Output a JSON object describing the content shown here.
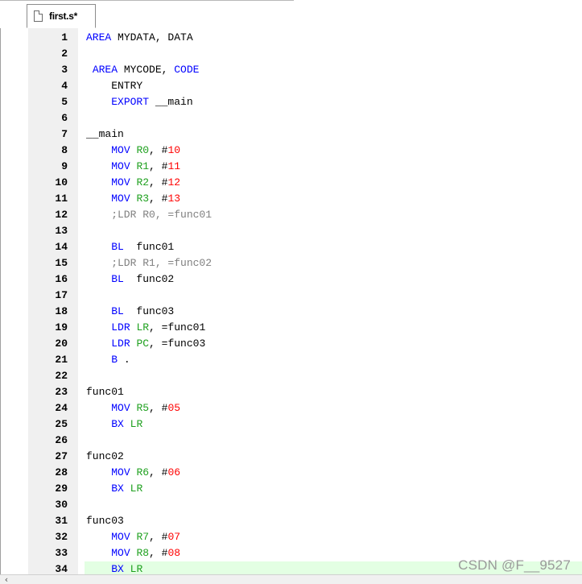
{
  "tab": {
    "label": "first.s*",
    "icon": "file-icon"
  },
  "editor": {
    "current_line": 34,
    "lines": [
      {
        "n": "1",
        "tokens": [
          {
            "t": "AREA",
            "c": "kw"
          },
          {
            "t": " MYDATA, DATA",
            "c": "plain"
          }
        ]
      },
      {
        "n": "2",
        "tokens": []
      },
      {
        "n": "3",
        "tokens": [
          {
            "t": " ",
            "c": "plain"
          },
          {
            "t": "AREA",
            "c": "kw"
          },
          {
            "t": " MYCODE, ",
            "c": "plain"
          },
          {
            "t": "CODE",
            "c": "kw"
          }
        ]
      },
      {
        "n": "4",
        "tokens": [
          {
            "t": "    ENTRY",
            "c": "plain"
          }
        ]
      },
      {
        "n": "5",
        "tokens": [
          {
            "t": "    ",
            "c": "plain"
          },
          {
            "t": "EXPORT",
            "c": "kw"
          },
          {
            "t": " __main",
            "c": "plain"
          }
        ]
      },
      {
        "n": "6",
        "tokens": []
      },
      {
        "n": "7",
        "tokens": [
          {
            "t": "__main",
            "c": "plain"
          }
        ]
      },
      {
        "n": "8",
        "tokens": [
          {
            "t": "    ",
            "c": "plain"
          },
          {
            "t": "MOV",
            "c": "kw"
          },
          {
            "t": " ",
            "c": "plain"
          },
          {
            "t": "R0",
            "c": "reg"
          },
          {
            "t": ", #",
            "c": "plain"
          },
          {
            "t": "10",
            "c": "num"
          }
        ]
      },
      {
        "n": "9",
        "tokens": [
          {
            "t": "    ",
            "c": "plain"
          },
          {
            "t": "MOV",
            "c": "kw"
          },
          {
            "t": " ",
            "c": "plain"
          },
          {
            "t": "R1",
            "c": "reg"
          },
          {
            "t": ", #",
            "c": "plain"
          },
          {
            "t": "11",
            "c": "num"
          }
        ]
      },
      {
        "n": "10",
        "tokens": [
          {
            "t": "    ",
            "c": "plain"
          },
          {
            "t": "MOV",
            "c": "kw"
          },
          {
            "t": " ",
            "c": "plain"
          },
          {
            "t": "R2",
            "c": "reg"
          },
          {
            "t": ", #",
            "c": "plain"
          },
          {
            "t": "12",
            "c": "num"
          }
        ]
      },
      {
        "n": "11",
        "tokens": [
          {
            "t": "    ",
            "c": "plain"
          },
          {
            "t": "MOV",
            "c": "kw"
          },
          {
            "t": " ",
            "c": "plain"
          },
          {
            "t": "R3",
            "c": "reg"
          },
          {
            "t": ", #",
            "c": "plain"
          },
          {
            "t": "13",
            "c": "num"
          }
        ]
      },
      {
        "n": "12",
        "tokens": [
          {
            "t": "    ;LDR R0, =func01",
            "c": "cmt"
          }
        ]
      },
      {
        "n": "13",
        "tokens": []
      },
      {
        "n": "14",
        "tokens": [
          {
            "t": "    ",
            "c": "plain"
          },
          {
            "t": "BL",
            "c": "kw"
          },
          {
            "t": "  func01",
            "c": "plain"
          }
        ]
      },
      {
        "n": "15",
        "tokens": [
          {
            "t": "    ;LDR R1, =func02",
            "c": "cmt"
          }
        ]
      },
      {
        "n": "16",
        "tokens": [
          {
            "t": "    ",
            "c": "plain"
          },
          {
            "t": "BL",
            "c": "kw"
          },
          {
            "t": "  func02",
            "c": "plain"
          }
        ]
      },
      {
        "n": "17",
        "tokens": []
      },
      {
        "n": "18",
        "tokens": [
          {
            "t": "    ",
            "c": "plain"
          },
          {
            "t": "BL",
            "c": "kw"
          },
          {
            "t": "  func03",
            "c": "plain"
          }
        ]
      },
      {
        "n": "19",
        "tokens": [
          {
            "t": "    ",
            "c": "plain"
          },
          {
            "t": "LDR",
            "c": "kw"
          },
          {
            "t": " ",
            "c": "plain"
          },
          {
            "t": "LR",
            "c": "reg"
          },
          {
            "t": ", =func01",
            "c": "plain"
          }
        ]
      },
      {
        "n": "20",
        "tokens": [
          {
            "t": "    ",
            "c": "plain"
          },
          {
            "t": "LDR",
            "c": "kw"
          },
          {
            "t": " ",
            "c": "plain"
          },
          {
            "t": "PC",
            "c": "reg"
          },
          {
            "t": ", =func03",
            "c": "plain"
          }
        ]
      },
      {
        "n": "21",
        "tokens": [
          {
            "t": "    ",
            "c": "plain"
          },
          {
            "t": "B",
            "c": "kw"
          },
          {
            "t": " .",
            "c": "plain"
          }
        ]
      },
      {
        "n": "22",
        "tokens": []
      },
      {
        "n": "23",
        "tokens": [
          {
            "t": "func01",
            "c": "plain"
          }
        ]
      },
      {
        "n": "24",
        "tokens": [
          {
            "t": "    ",
            "c": "plain"
          },
          {
            "t": "MOV",
            "c": "kw"
          },
          {
            "t": " ",
            "c": "plain"
          },
          {
            "t": "R5",
            "c": "reg"
          },
          {
            "t": ", #",
            "c": "plain"
          },
          {
            "t": "05",
            "c": "num"
          }
        ]
      },
      {
        "n": "25",
        "tokens": [
          {
            "t": "    ",
            "c": "plain"
          },
          {
            "t": "BX",
            "c": "kw"
          },
          {
            "t": " ",
            "c": "plain"
          },
          {
            "t": "LR",
            "c": "reg"
          }
        ]
      },
      {
        "n": "26",
        "tokens": []
      },
      {
        "n": "27",
        "tokens": [
          {
            "t": "func02",
            "c": "plain"
          }
        ]
      },
      {
        "n": "28",
        "tokens": [
          {
            "t": "    ",
            "c": "plain"
          },
          {
            "t": "MOV",
            "c": "kw"
          },
          {
            "t": " ",
            "c": "plain"
          },
          {
            "t": "R6",
            "c": "reg"
          },
          {
            "t": ", #",
            "c": "plain"
          },
          {
            "t": "06",
            "c": "num"
          }
        ]
      },
      {
        "n": "29",
        "tokens": [
          {
            "t": "    ",
            "c": "plain"
          },
          {
            "t": "BX",
            "c": "kw"
          },
          {
            "t": " ",
            "c": "plain"
          },
          {
            "t": "LR",
            "c": "reg"
          }
        ]
      },
      {
        "n": "30",
        "tokens": []
      },
      {
        "n": "31",
        "tokens": [
          {
            "t": "func03",
            "c": "plain"
          }
        ]
      },
      {
        "n": "32",
        "tokens": [
          {
            "t": "    ",
            "c": "plain"
          },
          {
            "t": "MOV",
            "c": "kw"
          },
          {
            "t": " ",
            "c": "plain"
          },
          {
            "t": "R7",
            "c": "reg"
          },
          {
            "t": ", #",
            "c": "plain"
          },
          {
            "t": "07",
            "c": "num"
          }
        ]
      },
      {
        "n": "33",
        "tokens": [
          {
            "t": "    ",
            "c": "plain"
          },
          {
            "t": "MOV",
            "c": "kw"
          },
          {
            "t": " ",
            "c": "plain"
          },
          {
            "t": "R8",
            "c": "reg"
          },
          {
            "t": ", #",
            "c": "plain"
          },
          {
            "t": "08",
            "c": "num"
          }
        ]
      },
      {
        "n": "34",
        "tokens": [
          {
            "t": "    ",
            "c": "plain"
          },
          {
            "t": "BX",
            "c": "kw"
          },
          {
            "t": " ",
            "c": "plain"
          },
          {
            "t": "LR",
            "c": "reg"
          }
        ]
      }
    ]
  },
  "scrollbar": {
    "left_arrow": "‹",
    "icon": "chevron-left-icon"
  },
  "watermark": {
    "text": "CSDN @F__9527"
  },
  "colors": {
    "keyword": "#0000ff",
    "register": "#1ea01e",
    "number": "#ff0000",
    "comment": "#808080",
    "current_line_bg": "#e3ffe3",
    "gutter_bg": "#f0f0f0"
  }
}
